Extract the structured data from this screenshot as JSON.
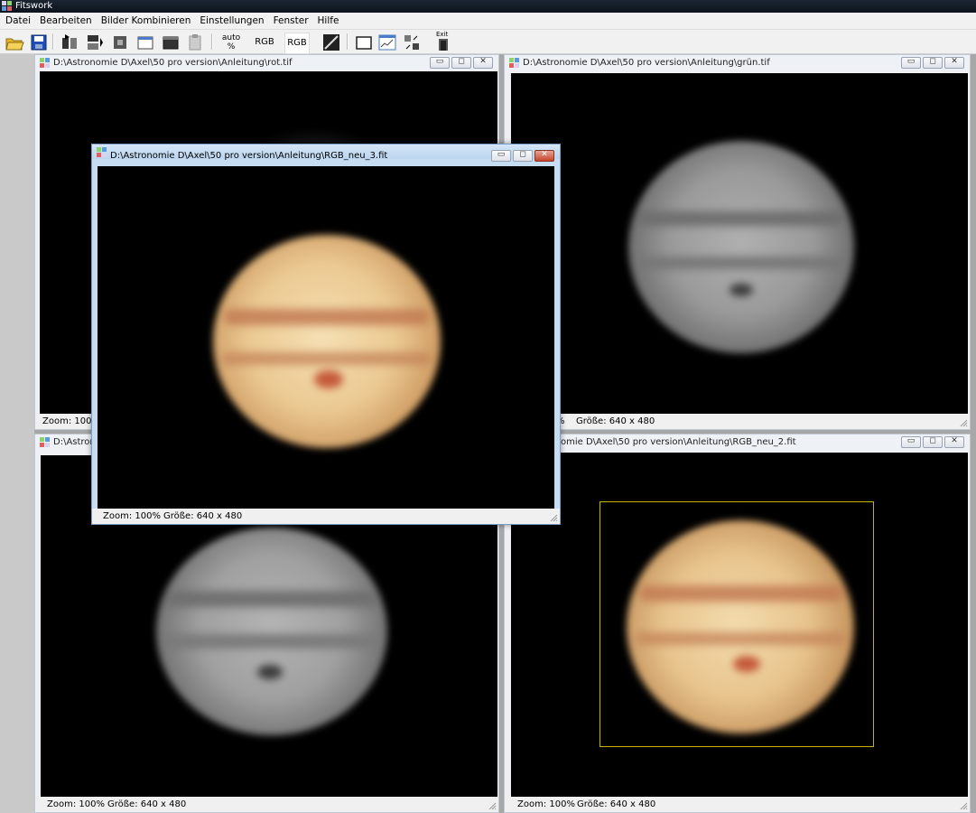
{
  "app": {
    "title": "Fitswork"
  },
  "menu": [
    "Datei",
    "Bearbeiten",
    "Bilder Kombinieren",
    "Einstellungen",
    "Fenster",
    "Hilfe"
  ],
  "toolbar": {
    "auto_label": "auto\n%",
    "rgb1": "RGB",
    "rgb2": "RGB",
    "exit_label": "Exit"
  },
  "windows": {
    "red": {
      "title": "D:\\Astronomie D\\Axel\\50 pro version\\Anleitung\\rot.tif",
      "zoom": "Zoom: 100%",
      "size": ""
    },
    "green": {
      "title": "D:\\Astronomie D\\Axel\\50 pro version\\Anleitung\\grün.tif",
      "zoom": "%",
      "size": "Größe: 640 x 480"
    },
    "blue": {
      "title": "D:\\Astron",
      "zoom": "Zoom: 100%",
      "size": "Größe: 640 x 480"
    },
    "rgb2": {
      "title": "omie D\\Axel\\50 pro version\\Anleitung\\RGB_neu_2.fit",
      "zoom": "Zoom: 100%",
      "size": "Größe: 640 x 480"
    },
    "rgb3": {
      "title": "D:\\Astronomie D\\Axel\\50 pro version\\Anleitung\\RGB_neu_3.fit",
      "zoom": "Zoom: 100%",
      "size": "Größe: 640 x 480"
    }
  },
  "colors": {
    "planet_color": "#e8c48d",
    "band_color": "#b86a44",
    "grey_planet": "#9a9a9a",
    "selection_frame": "#c8b400"
  }
}
